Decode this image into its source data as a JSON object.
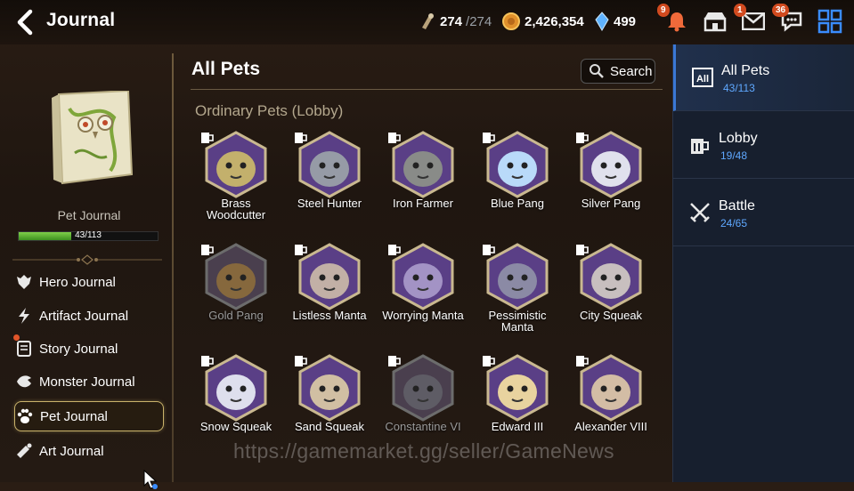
{
  "header": {
    "title": "Journal"
  },
  "resources": {
    "stamina": "274",
    "stamina_max": "/274",
    "gold": "2,426,354",
    "crystals": "499"
  },
  "top_icons": {
    "notice_badge": "9",
    "mail_badge": "1",
    "chat_badge": "36"
  },
  "left": {
    "pet_journal_label": "Pet Journal",
    "progress_text": "43/113",
    "progress_fraction": 0.38,
    "menu": [
      {
        "label": "Hero Journal",
        "icon": "hero-icon"
      },
      {
        "label": "Artifact Journal",
        "icon": "artifact-icon"
      },
      {
        "label": "Story Journal",
        "icon": "story-icon"
      },
      {
        "label": "Monster Journal",
        "icon": "monster-icon"
      },
      {
        "label": "Pet Journal",
        "icon": "paw-icon"
      },
      {
        "label": "Art Journal",
        "icon": "art-icon"
      }
    ]
  },
  "main": {
    "title": "All Pets",
    "search_label": "Search",
    "section": "Ordinary Pets (Lobby)",
    "pets": [
      {
        "name": "Brass Woodcutter",
        "locked": false,
        "color": "#c9b66a"
      },
      {
        "name": "Steel Hunter",
        "locked": false,
        "color": "#9aa0a8"
      },
      {
        "name": "Iron Farmer",
        "locked": false,
        "color": "#8c8f88"
      },
      {
        "name": "Blue Pang",
        "locked": false,
        "color": "#bfe3ff"
      },
      {
        "name": "Silver Pang",
        "locked": false,
        "color": "#e8eaf2"
      },
      {
        "name": "Gold Pang",
        "locked": true,
        "color": "#b88b2f"
      },
      {
        "name": "Listless Manta",
        "locked": false,
        "color": "#c8b6a8"
      },
      {
        "name": "Worrying Manta",
        "locked": false,
        "color": "#a898c8"
      },
      {
        "name": "Pessimistic Manta",
        "locked": false,
        "color": "#8e8ea6"
      },
      {
        "name": "City Squeak",
        "locked": false,
        "color": "#cfc6c2"
      },
      {
        "name": "Snow Squeak",
        "locked": false,
        "color": "#e6e8f2"
      },
      {
        "name": "Sand Squeak",
        "locked": false,
        "color": "#d8c6a4"
      },
      {
        "name": "Constantine VI",
        "locked": true,
        "color": "#6f7478"
      },
      {
        "name": "Edward III",
        "locked": false,
        "color": "#f0dba0"
      },
      {
        "name": "Alexander VIII",
        "locked": false,
        "color": "#dac4a6"
      }
    ]
  },
  "right": {
    "tabs": [
      {
        "label": "All Pets",
        "count": "43/113",
        "icon": "all-icon"
      },
      {
        "label": "Lobby",
        "count": "19/48",
        "icon": "mug-icon"
      },
      {
        "label": "Battle",
        "count": "24/65",
        "icon": "swords-icon"
      }
    ]
  },
  "watermark": "https://gamemarket.gg/seller/GameNews"
}
